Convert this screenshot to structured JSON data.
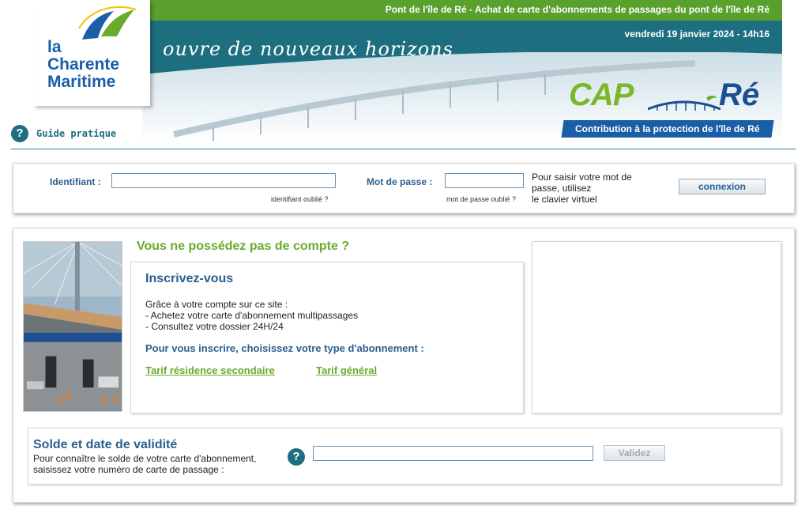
{
  "header": {
    "topbar_title": "Pont de l'île de Ré - Achat de carte d'abonnements de passages du pont de l'île de Ré",
    "date": "vendredi 19 janvier 2024 - 14h16",
    "slogan": "ouvre de nouveaux horizons",
    "logo_line1": "la",
    "logo_line2": "Charente",
    "logo_line3": "Maritime",
    "cap_word": "CAP",
    "re_word": "Ré",
    "cap_tagline": "Contribution à la protection de l'île de Ré",
    "guide_label": "Guide pratique",
    "help_glyph": "?"
  },
  "login": {
    "identifiant_label": "Identifiant :",
    "identifiant_value": "",
    "identifiant_forgot": "identifiant oublié ?",
    "password_label": "Mot de passe :",
    "password_value": "",
    "password_forgot": "mot de passe oublié ?",
    "virtual_keyboard_text_1": "Pour saisir votre mot de",
    "virtual_keyboard_text_2": "passe, utilisez",
    "virtual_keyboard_text_3": "le clavier virtuel",
    "connect_button": "connexion"
  },
  "register": {
    "no_account_title": "Vous ne possédez pas de compte ?",
    "inscrivez_title": "Inscrivez-vous",
    "grace_line1": "Grâce à votre compte sur ce site :",
    "grace_line2": "- Achetez votre carte d'abonnement multipassages",
    "grace_line3": "- Consultez votre dossier 24H/24",
    "choose_text": "Pour vous inscrire, choisissez votre type d'abonnement :",
    "tarif_secondaire": "Tarif résidence secondaire",
    "tarif_general": "Tarif général"
  },
  "solde": {
    "title": "Solde et date de validité",
    "line1": "Pour connaître le solde de votre carte d'abonnement,",
    "line2": "saisissez votre numéro de carte de passage :",
    "card_number_value": "",
    "validate_button": "Validez",
    "help_glyph": "?"
  },
  "colors": {
    "brand_green": "#5aa02c",
    "brand_teal": "#1d6f7f",
    "link_green": "#6aaa2c",
    "title_blue": "#2b5f8e"
  }
}
